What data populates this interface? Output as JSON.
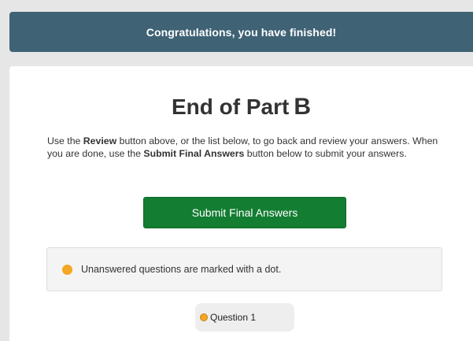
{
  "banner": {
    "text": "Congratulations, you have finished!"
  },
  "page": {
    "title": "End of Part",
    "part_letter": "B"
  },
  "instructions": {
    "seg1": "Use the ",
    "review_bold": "Review",
    "seg2": " button above, or the list below, to go back and review your answers. When you are done, use the ",
    "submit_bold": "Submit Final Answers",
    "seg3": " button below to submit your answers."
  },
  "submit_button": {
    "label": "Submit Final Answers"
  },
  "notice": {
    "text": "Unanswered questions are marked with a dot."
  },
  "questions": [
    {
      "label": "Question 1",
      "unanswered": true
    }
  ],
  "colors": {
    "banner_bg": "#3f6275",
    "submit_bg": "#137d32",
    "unanswered_dot": "#f5a623"
  }
}
